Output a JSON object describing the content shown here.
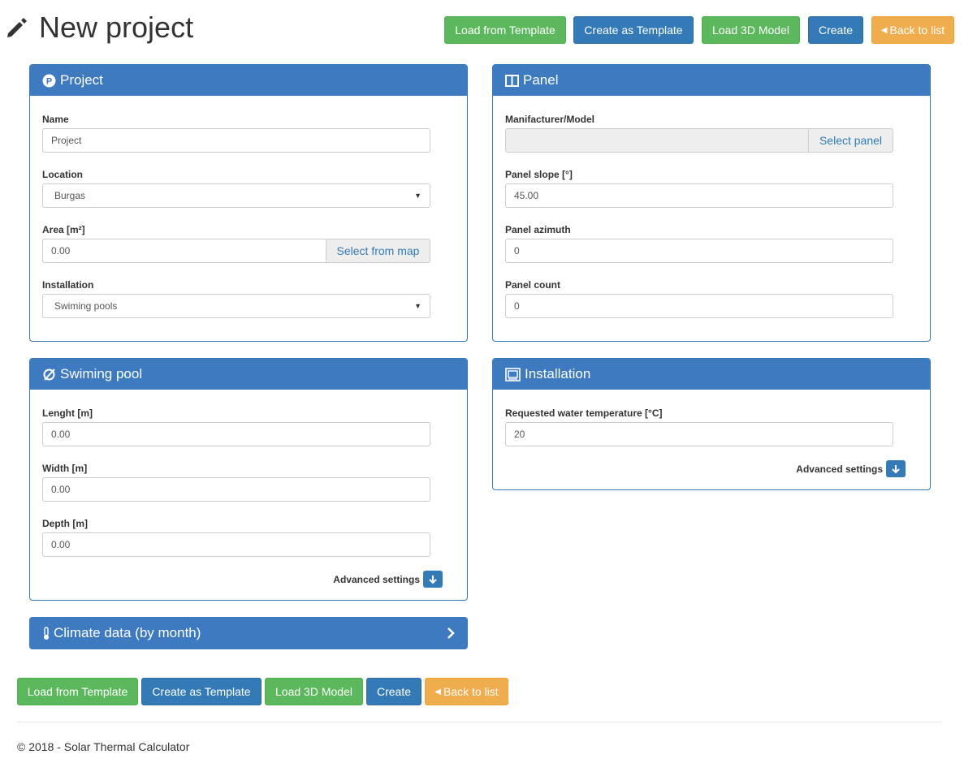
{
  "page": {
    "title": "New project"
  },
  "toolbar": {
    "load_template": "Load from Template",
    "create_template": "Create as Template",
    "load_3d": "Load 3D Model",
    "create": "Create",
    "back": "Back to list"
  },
  "project": {
    "heading": "Project",
    "name_label": "Name",
    "name_value": "Project",
    "location_label": "Location",
    "location_value": "Burgas",
    "area_label": "Area [m²]",
    "area_value": "0.00",
    "area_button": "Select from map",
    "installation_label": "Installation",
    "installation_value": "Swiming pools"
  },
  "panel": {
    "heading": "Panel",
    "model_label": "Manifacturer/Model",
    "model_value": "",
    "select_button": "Select panel",
    "slope_label": "Panel slope [°]",
    "slope_value": "45.00",
    "azimuth_label": "Panel azimuth",
    "azimuth_value": "0",
    "count_label": "Panel count",
    "count_value": "0"
  },
  "pool": {
    "heading": "Swiming pool",
    "length_label": "Lenght [m]",
    "length_value": "0.00",
    "width_label": "Width [m]",
    "width_value": "0.00",
    "depth_label": "Depth [m]",
    "depth_value": "0.00",
    "advanced": "Advanced settings"
  },
  "installation": {
    "heading": "Installation",
    "temp_label": "Requested water temperature [°C]",
    "temp_value": "20",
    "advanced": "Advanced settings"
  },
  "climate": {
    "heading": "Climate data (by month)"
  },
  "footer": {
    "text": "© 2018 - Solar Thermal Calculator"
  },
  "colors": {
    "primary": "#337ab7",
    "heading_bg": "#3d7ac0",
    "success": "#5cb85c",
    "warning": "#f0ad4e"
  },
  "icons": {
    "title": "pencil-icon",
    "project": "parking-circle-icon",
    "panel": "columns-icon",
    "pool": "circle-slash-icon",
    "installation": "installation-screen-icon",
    "climate": "thermometer-icon",
    "advanced": "arrow-down-icon",
    "expand": "chevron-right-icon"
  }
}
